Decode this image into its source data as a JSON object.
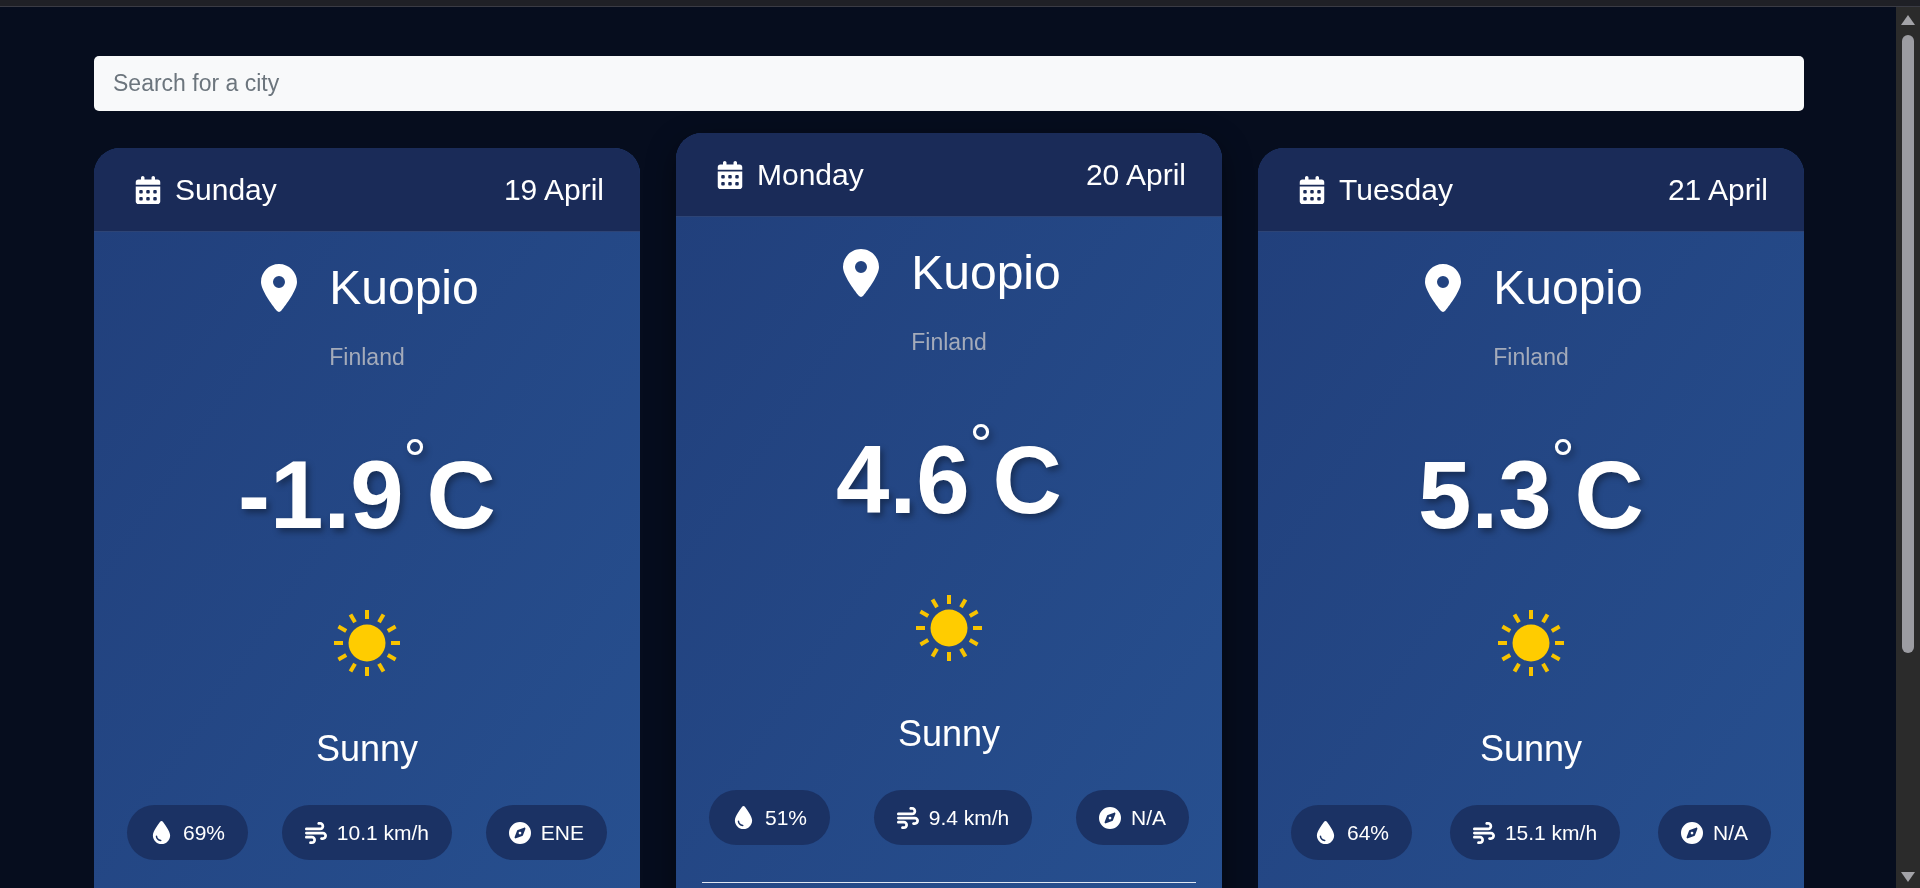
{
  "search": {
    "placeholder": "Search for a city"
  },
  "days": [
    {
      "day": "Sunday",
      "date": "19 April",
      "selected": false,
      "city": "Kuopio",
      "country": "Finland",
      "temperature": "-1.9$^{°}$C",
      "weather_icon": {
        "kind": "sun"
      },
      "condition": "Sunny",
      "stats": [
        {
          "kind": "humidity",
          "value": "69%"
        },
        {
          "kind": "wind",
          "value": "10.1 km/h"
        },
        {
          "kind": "direction",
          "value": "ENE"
        }
      ]
    },
    {
      "day": "Monday",
      "date": "20 April",
      "selected": true,
      "city": "Kuopio",
      "country": "Finland",
      "temperature": "4.6$^{°}$C",
      "weather_icon": {
        "kind": "sun"
      },
      "condition": "Sunny",
      "stats": [
        {
          "kind": "humidity",
          "value": "51%"
        },
        {
          "kind": "wind",
          "value": "9.4 km/h"
        },
        {
          "kind": "direction",
          "value": "N/A"
        }
      ]
    },
    {
      "day": "Tuesday",
      "date": "21 April",
      "selected": false,
      "city": "Kuopio",
      "country": "Finland",
      "temperature": "5.3$^{°}$C",
      "weather_icon": {
        "kind": "sun"
      },
      "condition": "Sunny",
      "stats": [
        {
          "kind": "humidity",
          "value": "64%"
        },
        {
          "kind": "wind",
          "value": "15.1 km/h"
        },
        {
          "kind": "direction",
          "value": "N/A"
        }
      ]
    }
  ]
}
